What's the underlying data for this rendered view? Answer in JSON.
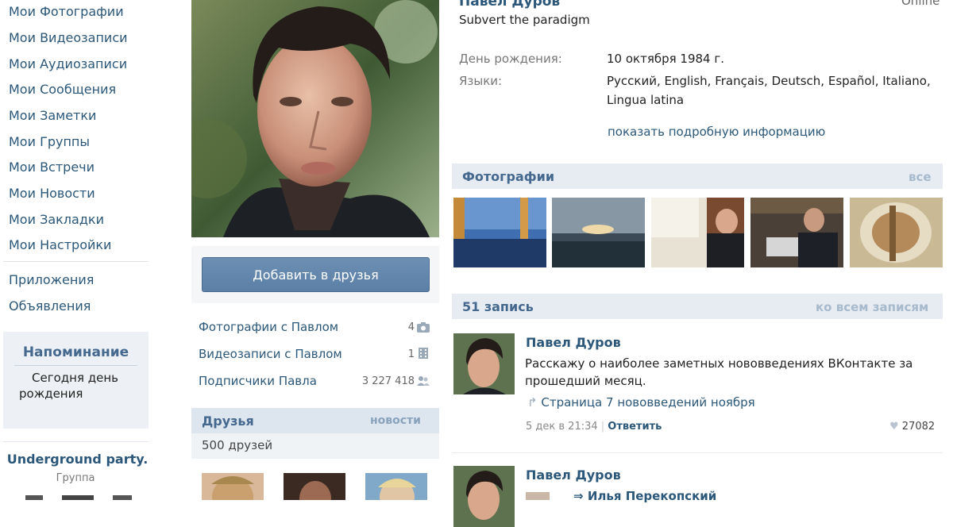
{
  "nav": {
    "items": [
      "Мои Фотографии",
      "Мои Видеозаписи",
      "Мои Аудиозаписи",
      "Мои Сообщения",
      "Мои Заметки",
      "Мои Группы",
      "Мои Встречи",
      "Мои Новости",
      "Мои Закладки",
      "Мои Настройки"
    ],
    "extra": [
      "Приложения",
      "Объявления"
    ]
  },
  "reminder": {
    "title": "Напоминание",
    "line1": "Сегодня",
    "line1b": "день",
    "line2": "рождения"
  },
  "group": {
    "name": "Underground party.",
    "type": "Группа"
  },
  "profile": {
    "name": "Павел Дуров",
    "status": "Subvert the paradigm",
    "online": "Online",
    "birthday_label": "День рождения:",
    "birthday_value": "10 октября 1984 г.",
    "languages_label": "Языки:",
    "languages_value": "Русский, English, Français, Deutsch, Español, Italiano, Lingua latina",
    "show_details": "показать подробную информацию"
  },
  "actions": {
    "add_friend": "Добавить в друзья"
  },
  "links": {
    "photos_with": "Фотографии с Павлом",
    "photos_with_count": "4",
    "videos_with": "Видеозаписи с Павлом",
    "videos_with_count": "1",
    "followers": "Подписчики Павла",
    "followers_count": "3 227 418"
  },
  "friends": {
    "title": "Друзья",
    "news": "новости",
    "count": "500 друзей"
  },
  "photos": {
    "title": "Фотографии",
    "all": "все"
  },
  "wall": {
    "title": "51 запись",
    "all": "ко всем записям",
    "posts": [
      {
        "author": "Павел Дуров",
        "text": "Расскажу о наиболее заметных нововведениях ВКонтакте за прошедший месяц.",
        "share": "Страница 7 нововведений ноября",
        "date": "5 дек в 21:34",
        "reply": "Ответить",
        "likes": "27082"
      },
      {
        "author": "Павел Дуров",
        "share_to": "Илья Перекопский"
      }
    ]
  },
  "colors": {
    "link": "#2b587a",
    "header_bg": "#e6ecf2",
    "button": "#5b7fa6"
  }
}
